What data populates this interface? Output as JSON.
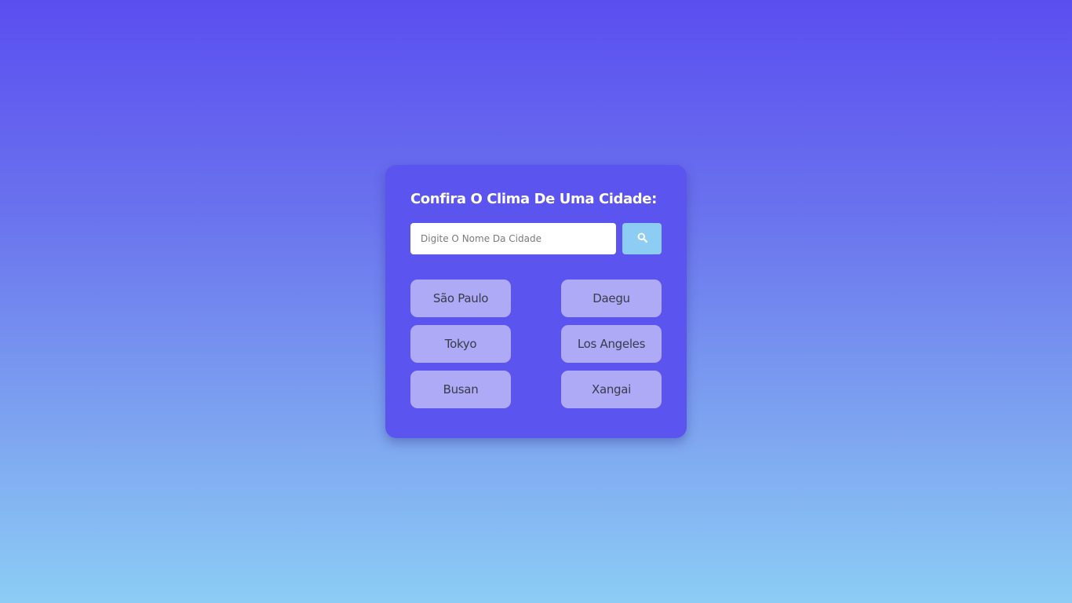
{
  "card": {
    "title": "Confira O Clima De Uma Cidade:"
  },
  "search": {
    "placeholder": "Digite O Nome Da Cidade",
    "value": "",
    "button_icon": "search-icon"
  },
  "cities": [
    {
      "label": "São Paulo"
    },
    {
      "label": "Daegu"
    },
    {
      "label": "Tokyo"
    },
    {
      "label": "Los Angeles"
    },
    {
      "label": "Busan"
    },
    {
      "label": "Xangai"
    }
  ],
  "colors": {
    "card_bg": "#5c54ee",
    "search_button_bg": "#8ecdf3",
    "city_button_bg": "#aeaaf6",
    "gradient_top": "#5b4ef0",
    "gradient_bottom": "#8ccdf5"
  }
}
